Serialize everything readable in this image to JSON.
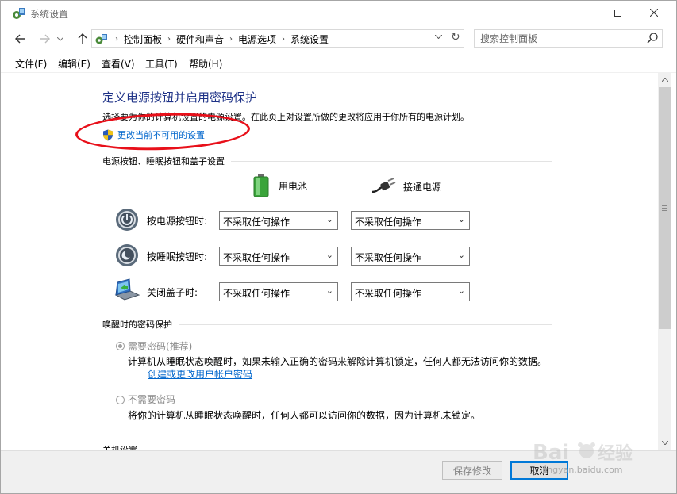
{
  "window": {
    "title": "系统设置",
    "minimize": "minimize",
    "maximize": "maximize",
    "close": "close"
  },
  "address": {
    "crumbs": [
      "控制面板",
      "硬件和声音",
      "电源选项",
      "系统设置"
    ]
  },
  "search": {
    "placeholder": "搜索控制面板"
  },
  "menu": [
    "文件(F)",
    "编辑(E)",
    "查看(V)",
    "工具(T)",
    "帮助(H)"
  ],
  "page": {
    "title": "定义电源按钮并启用密码保护",
    "description": "选择要为你的计算机设置的电源设置。在此页上对设置所做的更改将应用于你所有的电源计划。",
    "change_link": "更改当前不可用的设置"
  },
  "power_section": {
    "heading": "电源按钮、睡眠按钮和盖子设置",
    "col_battery": "用电池",
    "col_plugged": "接通电源",
    "rows": [
      {
        "label": "按电源按钮时:",
        "battery": "不采取任何操作",
        "plugged": "不采取任何操作",
        "icon": "power-button-icon"
      },
      {
        "label": "按睡眠按钮时:",
        "battery": "不采取任何操作",
        "plugged": "不采取任何操作",
        "icon": "sleep-button-icon"
      },
      {
        "label": "关闭盖子时:",
        "battery": "不采取任何操作",
        "plugged": "不采取任何操作",
        "icon": "laptop-lid-icon"
      }
    ]
  },
  "wake_section": {
    "heading": "唤醒时的密码保护",
    "require": {
      "label": "需要密码(推荐)",
      "selected": true,
      "description": "计算机从睡眠状态唤醒时，如果未输入正确的密码来解除计算机锁定，任何人都无法访问你的数据。",
      "link": "创建或更改用户帐户密码"
    },
    "not_require": {
      "label": "不需要密码",
      "selected": false,
      "description": "将你的计算机从睡眠状态唤醒时，任何人都可以访问你的数据，因为计算机未锁定。"
    },
    "next_heading_partial": "关机设置"
  },
  "footer": {
    "save": "保存修改",
    "cancel": "取消"
  },
  "watermark": {
    "text": "jingyan.baidu.com"
  },
  "colors": {
    "title_blue": "#1e3287",
    "link_blue": "#0066cc",
    "annotation_red": "#e8101a"
  }
}
